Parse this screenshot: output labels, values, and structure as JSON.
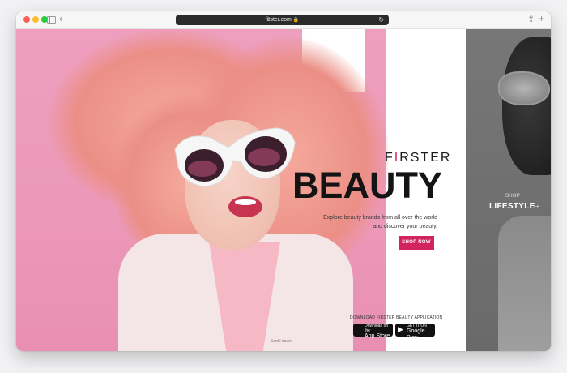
{
  "browser": {
    "url": "firster.com",
    "tab_count": "1"
  },
  "icons": {
    "back": "chevron-left-icon",
    "sidebar": "sidebar-icon",
    "share": "share-icon",
    "newtab": "plus-icon",
    "arrow": "arrow-right-icon"
  },
  "hero": {
    "brand_prefix": "F",
    "brand_i": "I",
    "brand_suffix": "RSTER",
    "title": "BEAUTY",
    "subtitle_line1": "Explore beauty brands from all over the world",
    "subtitle_line2": "and discover your beauty.",
    "shop_button": "SHOP NOW",
    "download_label": "DOWNLOAD FIRSTER BEAUTY APPLICATION",
    "app_store_small": "Download on the",
    "app_store_big": "App Store",
    "google_play_small": "GET IT ON",
    "google_play_big": "Google Play",
    "scroll_down": "Scroll down"
  },
  "side": {
    "kicker": "SHOP",
    "title": "LIFESTYLE"
  },
  "colors": {
    "accent": "#d2245e",
    "hero_bg": "#ec98b8",
    "side_bg": "#707070"
  }
}
